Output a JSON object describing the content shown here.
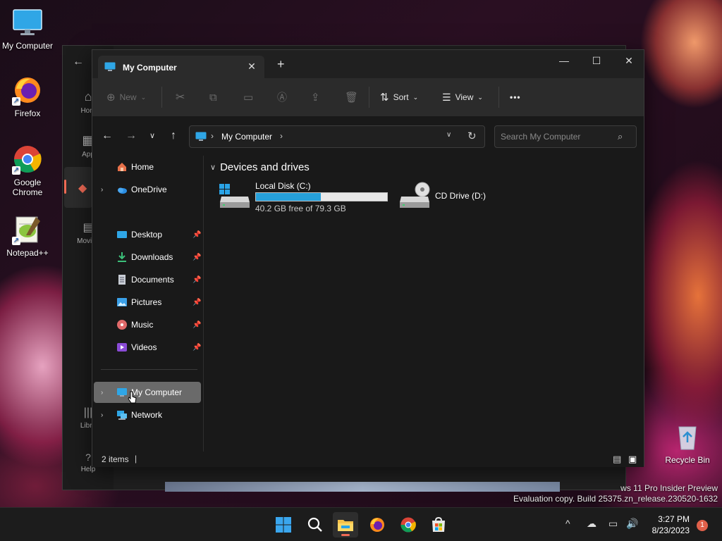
{
  "desktop": {
    "icons": [
      {
        "label": "My Computer"
      },
      {
        "label": "Firefox"
      },
      {
        "label": "Google Chrome"
      },
      {
        "label": "Notepad++"
      },
      {
        "label": "Recycle Bin"
      }
    ],
    "watermark_line1": "ws 11 Pro Insider Preview",
    "watermark_line2": "Evaluation copy. Build 25375.zn_release.230520-1632"
  },
  "bg_window": {
    "rail": [
      "Hom",
      "App",
      "Movies",
      "Libra",
      "Help"
    ]
  },
  "explorer": {
    "tab_title": "My Computer",
    "new_tab": "+",
    "toolbar": {
      "new_label": "New",
      "sort_label": "Sort",
      "view_label": "View",
      "more_label": "•••"
    },
    "address": {
      "segment": "My Computer",
      "separator": "›"
    },
    "search": {
      "placeholder": "Search My Computer"
    },
    "sidebar": {
      "home": "Home",
      "onedrive": "OneDrive",
      "desktop": "Desktop",
      "downloads": "Downloads",
      "documents": "Documents",
      "pictures": "Pictures",
      "music": "Music",
      "videos": "Videos",
      "my_computer": "My Computer",
      "network": "Network"
    },
    "content": {
      "group_title": "Devices and drives",
      "drives": [
        {
          "name": "Local Disk (C:)",
          "free_text": "40.2 GB free of 79.3 GB",
          "used_fraction": 0.493
        },
        {
          "name": "CD Drive (D:)"
        }
      ]
    },
    "status": {
      "items": "2 items",
      "cursor": "|"
    }
  },
  "taskbar": {
    "time": "3:27 PM",
    "date": "8/23/2023",
    "notification_count": "1"
  },
  "colors": {
    "accent": "#26a0da",
    "selection": "#6a6a6a",
    "notification": "#e0604a"
  }
}
